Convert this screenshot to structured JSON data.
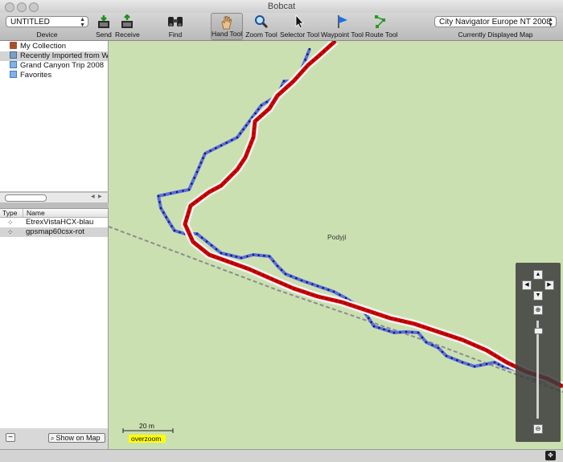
{
  "window": {
    "title": "Bobcat"
  },
  "toolbar": {
    "device_select": "UNTITLED",
    "device_label": "Device",
    "send": "Send",
    "receive": "Receive",
    "find": "Find",
    "hand_tool": "Hand Tool",
    "zoom_tool": "Zoom Tool",
    "selector_tool": "Selector Tool",
    "waypoint_tool": "Waypoint Tool",
    "route_tool": "Route Tool",
    "map_select": "City Navigator Europe NT 2008",
    "map_label": "Currently Displayed Map"
  },
  "collections": [
    {
      "label": "My Collection",
      "icon": "collection-icon",
      "selected": false
    },
    {
      "label": "Recently Imported from WaypointTool",
      "icon": "imported-folder-icon",
      "selected": true
    },
    {
      "label": "Grand Canyon Trip 2008",
      "icon": "folder-icon",
      "selected": false
    },
    {
      "label": "Favorites",
      "icon": "folder-icon",
      "selected": false
    }
  ],
  "tracks_table": {
    "headers": {
      "type": "Type",
      "name": "Name"
    },
    "rows": [
      {
        "name": "EtrexVistaHCX-blau",
        "selected": false
      },
      {
        "name": "gpsmap60csx-rot",
        "selected": true
      }
    ]
  },
  "bottom": {
    "remove": "−",
    "show_on_map": "Show on Map"
  },
  "map": {
    "place_label": "Podyjí",
    "scale_label": "20 m",
    "overzoom": "overzoom",
    "zoom_level": 0.92,
    "colors": {
      "land": "#cbe0b1",
      "red_track": "#d40000",
      "blue_track": "#5a6fe0",
      "border": "#8c8c8c"
    }
  }
}
